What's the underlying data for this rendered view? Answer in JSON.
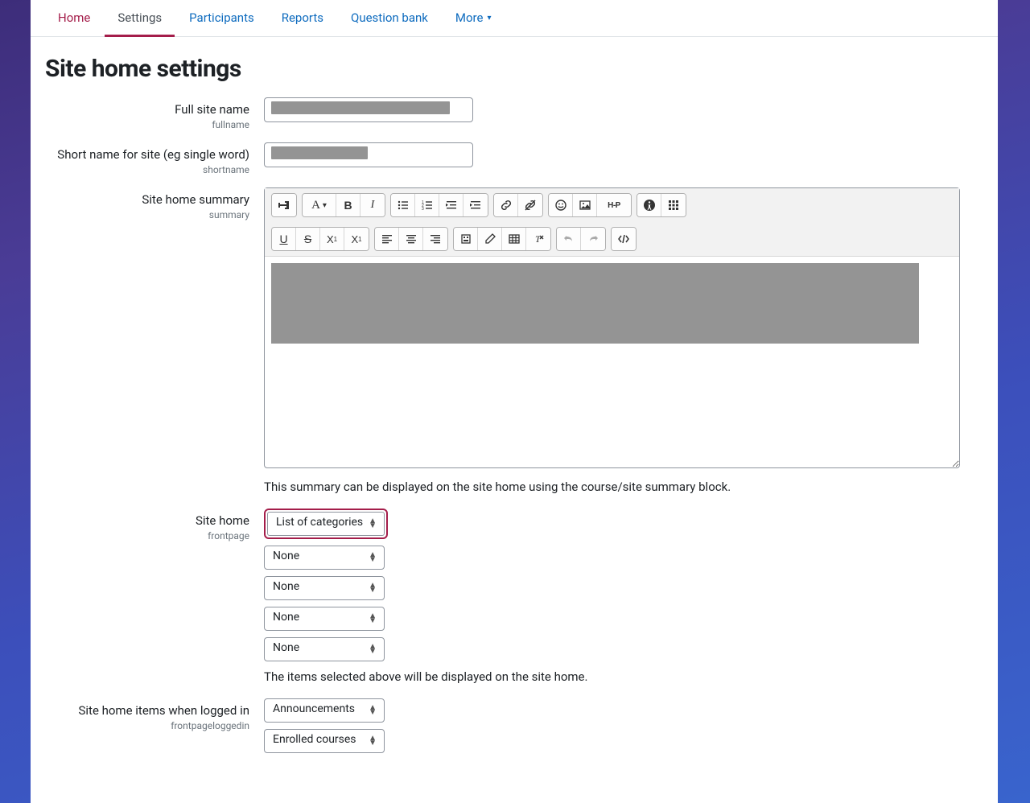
{
  "tabs": {
    "home": "Home",
    "settings": "Settings",
    "participants": "Participants",
    "reports": "Reports",
    "questionbank": "Question bank",
    "more": "More"
  },
  "page_title": "Site home settings",
  "fields": {
    "fullname": {
      "label": "Full site name",
      "sub": "fullname"
    },
    "shortname": {
      "label": "Short name for site (eg single word)",
      "sub": "shortname"
    },
    "summary": {
      "label": "Site home summary",
      "sub": "summary",
      "hint": "This summary can be displayed on the site home using the course/site summary block."
    },
    "frontpage": {
      "label": "Site home",
      "sub": "frontpage",
      "selects": [
        "List of categories",
        "None",
        "None",
        "None",
        "None"
      ],
      "hint": "The items selected above will be displayed on the site home."
    },
    "frontpageloggedin": {
      "label": "Site home items when logged in",
      "sub": "frontpageloggedin",
      "selects": [
        "Announcements",
        "Enrolled courses"
      ]
    }
  }
}
